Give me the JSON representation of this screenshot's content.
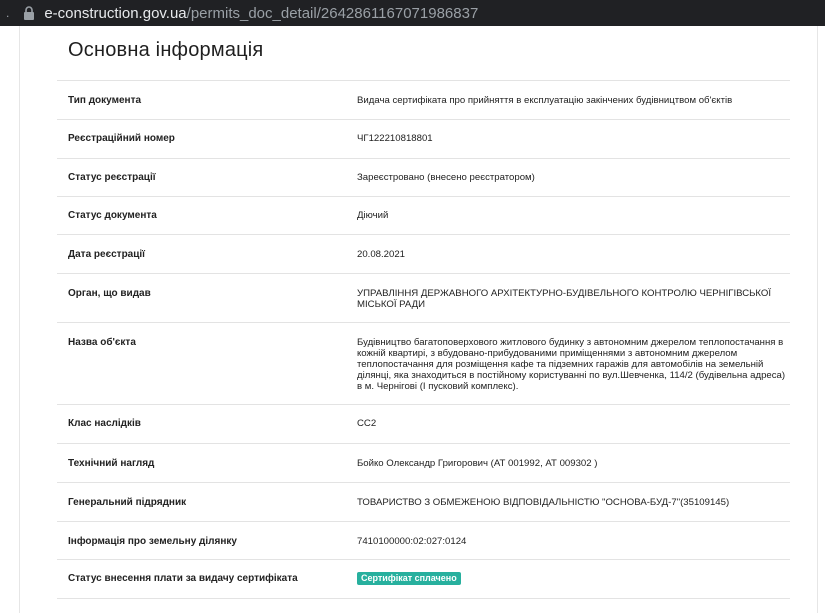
{
  "browser": {
    "host": "e-construction.gov.ua",
    "path": "/permits_doc_detail/264286116707198683 7"
  },
  "page": {
    "title": "Основна інформація"
  },
  "rows": [
    {
      "label": "Тип документа",
      "value": "Видача сертифіката про прийняття в експлуатацію закінчених будівництвом об'єктів"
    },
    {
      "label": "Реєстраційний номер",
      "value": "ЧГ122210818801"
    },
    {
      "label": "Статус реєстрації",
      "value": "Зареєстровано (внесено реєстратором)"
    },
    {
      "label": "Статус документа",
      "value": "Діючий"
    },
    {
      "label": "Дата реєстрації",
      "value": "20.08.2021"
    },
    {
      "label": "Орган, що видав",
      "value": "УПРАВЛІННЯ ДЕРЖАВНОГО АРХІТЕКТУРНО-БУДІВЕЛЬНОГО КОНТРОЛЮ ЧЕРНІГІВСЬКОЇ МІСЬКОЇ РАДИ"
    },
    {
      "label": "Назва об'єкта",
      "value": "Будівництво багатоповерхового житлового будинку з автономним джерелом теплопостачання в кожній квартирі, з вбудовано-прибудованими приміщеннями з автономним джерелом теплопостачання для розміщення кафе та підземних гаражів для автомобілів на земельній ділянці, яка знаходиться в постійному користуванні по вул.Шевченка, 114/2 (будівельна адреса) в м. Чернігові (І пусковий комплекс)."
    },
    {
      "label": "Клас наслідків",
      "value": "СС2"
    },
    {
      "label": "Технічний нагляд",
      "value": "Бойко Олександр Григорович (АТ 001992, АТ 009302 )"
    },
    {
      "label": "Генеральний підрядник",
      "value": "ТОВАРИСТВО З ОБМЕЖЕНОЮ ВІДПОВІДАЛЬНІСТЮ \"ОСНОВА-БУД-7\"(35109145)"
    },
    {
      "label": "Інформація про земельну ділянку",
      "value": "7410100000:02:027:0124"
    },
    {
      "label": "Статус внесення плати за видачу сертифіката",
      "badge": "Сертифікат сплачено"
    }
  ]
}
